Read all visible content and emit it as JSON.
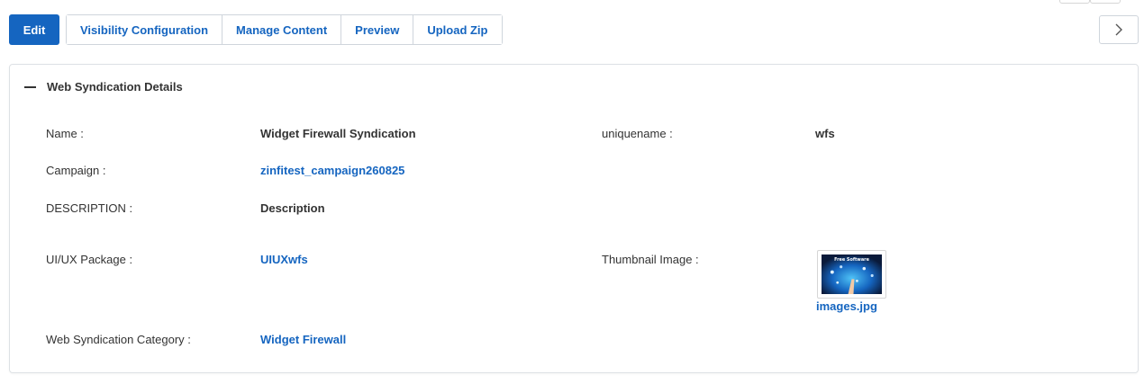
{
  "toolbar": {
    "edit_label": "Edit",
    "visibility_label": "Visibility Configuration",
    "manage_content_label": "Manage Content",
    "preview_label": "Preview",
    "upload_zip_label": "Upload Zip"
  },
  "panel": {
    "title": "Web Syndication Details",
    "fields": {
      "name_label": "Name :",
      "name_value": "Widget Firewall Syndication",
      "uniquename_label": "uniquename :",
      "uniquename_value": "wfs",
      "campaign_label": "Campaign :",
      "campaign_value": "zinfitest_campaign260825",
      "description_label": "DESCRIPTION :",
      "description_value": "Description",
      "uiux_label": "UI/UX Package :",
      "uiux_value": "UIUXwfs",
      "thumbnail_label": "Thumbnail Image :",
      "thumbnail_file": "images.jpg",
      "thumbnail_caption": "Free Software",
      "category_label": "Web Syndication Category :",
      "category_value": "Widget Firewall"
    }
  },
  "icons": {
    "collapse": "minus-icon",
    "next": "chevron-right-icon"
  },
  "colors": {
    "accent": "#1565c0",
    "text": "#333333",
    "border": "#dde1e5"
  }
}
